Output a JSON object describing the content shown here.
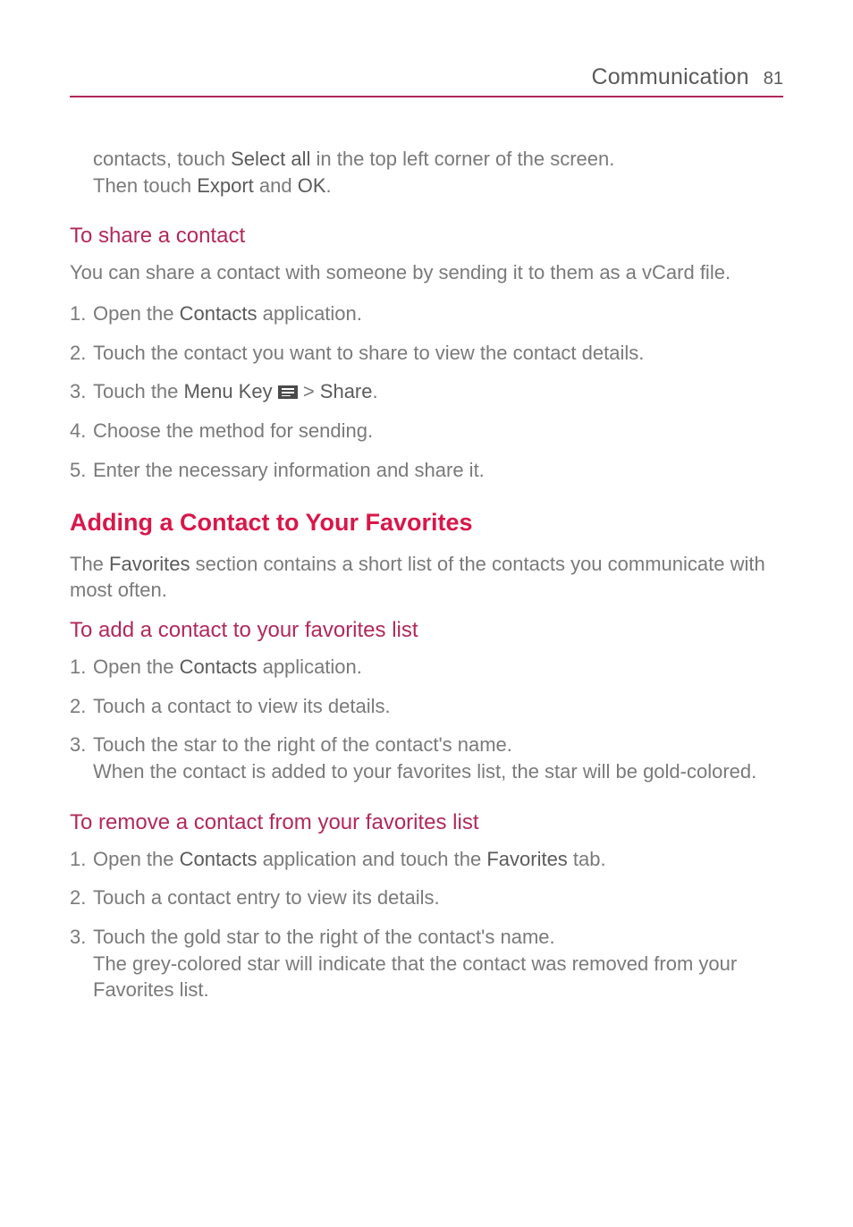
{
  "header": {
    "title": "Communication",
    "page_number": "81"
  },
  "intro": {
    "line1_prefix": "contacts, touch ",
    "line1_bold": "Select all",
    "line1_suffix": " in the top left corner of the screen.",
    "line2_prefix": "Then touch ",
    "line2_b1": "Export",
    "line2_mid": " and ",
    "line2_b2": "OK",
    "line2_suffix": "."
  },
  "share": {
    "heading": "To share a contact",
    "lead": "You can share a contact with someone by sending it to them as a vCard file.",
    "step1": {
      "num": "1.",
      "pre": "Open the ",
      "bold": "Contacts",
      "post": " application."
    },
    "step2": {
      "num": "2.",
      "text": "Touch the contact you want to share to view the contact details."
    },
    "step3": {
      "num": "3.",
      "pre": "Touch the ",
      "b1": "Menu Key",
      "mid": " > ",
      "b2": "Share",
      "post": "."
    },
    "step4": {
      "num": "4.",
      "text": "Choose the method for sending."
    },
    "step5": {
      "num": "5.",
      "text": "Enter the necessary information and share it."
    }
  },
  "favorites": {
    "heading": "Adding a Contact to Your Favorites",
    "lead_pre": "The ",
    "lead_bold": "Favorites",
    "lead_post": " section contains a short list of the contacts you communicate with most often.",
    "add": {
      "heading": "To add a contact to your favorites list",
      "step1": {
        "num": "1.",
        "pre": "Open the ",
        "bold": "Contacts",
        "post": " application."
      },
      "step2": {
        "num": "2.",
        "text": "Touch a contact to view its details."
      },
      "step3": {
        "num": "3.",
        "l1": "Touch the star to the right of the contact's name.",
        "l2": "When the contact is added to your favorites list, the star will be gold-colored."
      }
    },
    "remove": {
      "heading": "To remove a contact from your favorites list",
      "step1": {
        "num": "1.",
        "pre": "Open the ",
        "b1": "Contacts",
        "mid": " application and touch the ",
        "b2": "Favorites",
        "post": " tab."
      },
      "step2": {
        "num": "2.",
        "text": "Touch a contact entry to view its details."
      },
      "step3": {
        "num": "3.",
        "l1": "Touch the gold star to the right of the contact's name.",
        "l2": "The grey-colored star will indicate that the contact was removed from your Favorites list."
      }
    }
  }
}
